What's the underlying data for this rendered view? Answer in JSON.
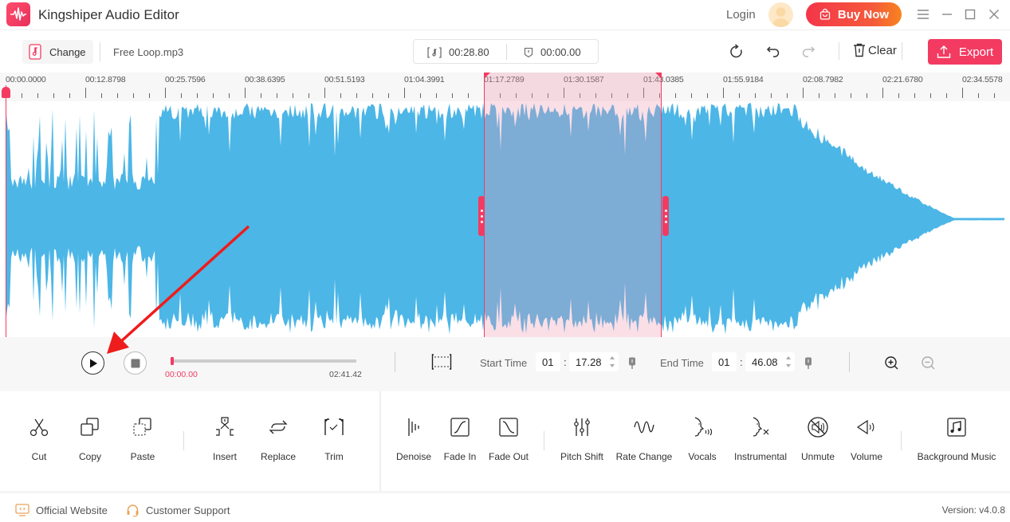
{
  "app": {
    "title": "Kingshiper Audio Editor",
    "login_label": "Login",
    "buy_now_label": "Buy Now",
    "brand_color": "#f33b62"
  },
  "toolbar": {
    "change_label": "Change",
    "file_name": "Free Loop.mp3",
    "selection_duration": "00:28.80",
    "marker_time": "00:00.00",
    "clear_label": "Clear",
    "export_label": "Export"
  },
  "ruler": {
    "labels": [
      "00:00.0000",
      "00:12.8798",
      "00:25.7596",
      "00:38.6395",
      "00:51.5193",
      "01:04.3991",
      "01:17.2789",
      "01:30.1587",
      "01:43.0385",
      "01:55.9184",
      "02:08.7982",
      "02:21.6780",
      "02:34.5578"
    ]
  },
  "waveform": {
    "color": "#4cb6e6",
    "selection_start_seconds": 77.28,
    "selection_end_seconds": 106.08,
    "total_seconds": 161.42
  },
  "playback": {
    "current_time": "00:00.00",
    "total_time": "02:41.42",
    "progress_fraction": 0.0,
    "start_time_label": "Start Time",
    "start_min": "01",
    "start_sec": "17.28",
    "end_time_label": "End Time",
    "end_min": "01",
    "end_sec": "46.08"
  },
  "tools": {
    "edit": [
      {
        "id": "cut",
        "label": "Cut"
      },
      {
        "id": "copy",
        "label": "Copy"
      },
      {
        "id": "paste",
        "label": "Paste"
      },
      {
        "id": "insert",
        "label": "Insert"
      },
      {
        "id": "replace",
        "label": "Replace"
      },
      {
        "id": "trim",
        "label": "Trim"
      }
    ],
    "effects": [
      {
        "id": "denoise",
        "label": "Denoise"
      },
      {
        "id": "fade-in",
        "label": "Fade In"
      },
      {
        "id": "fade-out",
        "label": "Fade Out"
      },
      {
        "id": "pitch-shift",
        "label": "Pitch Shift"
      },
      {
        "id": "rate-change",
        "label": "Rate Change"
      },
      {
        "id": "vocals",
        "label": "Vocals"
      },
      {
        "id": "instrumental",
        "label": "Instrumental"
      },
      {
        "id": "unmute",
        "label": "Unmute"
      },
      {
        "id": "volume",
        "label": "Volume"
      },
      {
        "id": "background-music",
        "label": "Background Music"
      }
    ]
  },
  "footer": {
    "official_website": "Official Website",
    "customer_support": "Customer Support",
    "version": "Version: v4.0.8"
  }
}
